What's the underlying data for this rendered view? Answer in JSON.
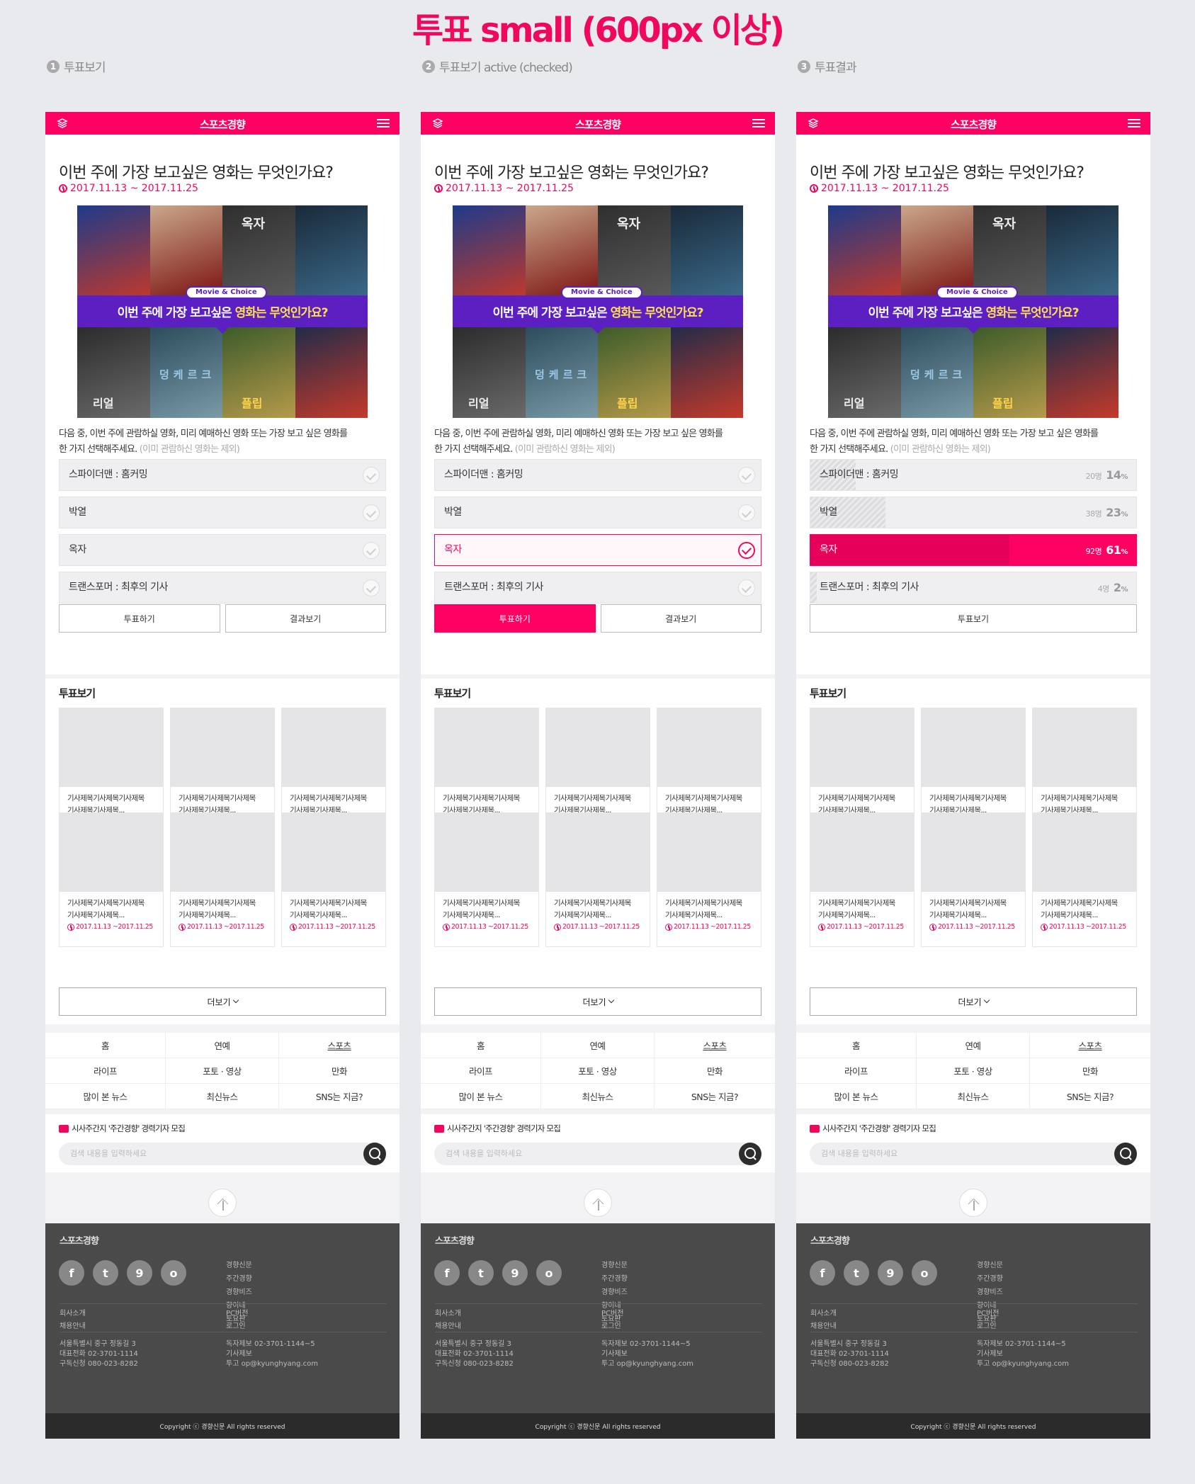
{
  "page_title": "투표 small (600px 이상)",
  "site": {
    "logo": "스포츠경향"
  },
  "columns": [
    {
      "number": "1",
      "label": "투표보기",
      "state": "default"
    },
    {
      "number": "2",
      "label": "투표보기 active (checked)",
      "state": "checked"
    },
    {
      "number": "3",
      "label": "투표결과",
      "state": "result"
    }
  ],
  "vote": {
    "question": "이번 주에 가장 보고싶은 영화는 무엇인가요?",
    "date": "2017.11.13 ~ 2017.11.25",
    "banner_pill": "Movie & Choice",
    "banner_text": "이번 주에 가장 보고싶은",
    "banner_highlight": "영화는 무엇인가요?",
    "poster_titles": [
      "옥자",
      "리얼",
      "덩케르크",
      "플립"
    ],
    "desc_line1": "다음 중, 이번 주에 관람하실 영화, 미리 예매하신 영화 또는 가장 보고 싶은 영화를",
    "desc_line2": "한 가지 선택해주세요.",
    "desc_muted": "(이미 관람하신 영화는 제외)",
    "options": [
      {
        "label": "스파이더맨 : 홈커밍",
        "count": "20명",
        "percent": 14
      },
      {
        "label": "박열",
        "count": "38명",
        "percent": 23
      },
      {
        "label": "옥자",
        "count": "92명",
        "percent": 61
      },
      {
        "label": "트랜스포머 : 최후의 기사",
        "count": "4명",
        "percent": 2
      }
    ],
    "checked_index": 2,
    "winner_index": 2,
    "percent_unit": "%",
    "vote_button": "투표하기",
    "result_button": "결과보기",
    "result_back_button": "투표보기"
  },
  "list": {
    "heading": "투표보기",
    "card_title_line1": "기사제목기사제목기사제목",
    "card_title_line2": "기사제목기사제목...",
    "card_date": "2017.11.13 ~2017.11.25",
    "more_label": "더보기"
  },
  "nav": [
    "홈",
    "연예",
    "스포츠",
    "라이프",
    "포토 · 영상",
    "만화",
    "많이 본 뉴스",
    "최신뉴스",
    "SNS는 지금?"
  ],
  "search": {
    "notice": "시사주간지 '주간경향' 경력기자 모집",
    "placeholder": "검색 내용을 입력하세요"
  },
  "footer": {
    "logo": "스포츠경향",
    "social": [
      "f",
      "t",
      "9",
      "o"
    ],
    "links": [
      "경향신문",
      "주간경향",
      "경향비즈",
      "향이네",
      "토요판"
    ],
    "row1_left": [
      "회사소개",
      "채용안내"
    ],
    "row1_right": [
      "PC버전",
      "로그인"
    ],
    "row2_left": [
      "서울특별시 중구 정동길 3",
      "대표전화 02-3701-1114",
      "구독신청 080-023-8282"
    ],
    "row2_right": [
      "독자제보 02-3701-1144~5",
      "기사제보",
      "투고 op@kyunghyang.com"
    ],
    "copyright": "Copyright ⓒ 경향신문 All rights reserved"
  },
  "colors": {
    "accent": "#fe0062",
    "banner": "#5b1fc2",
    "footer": "#4a4a4a"
  }
}
